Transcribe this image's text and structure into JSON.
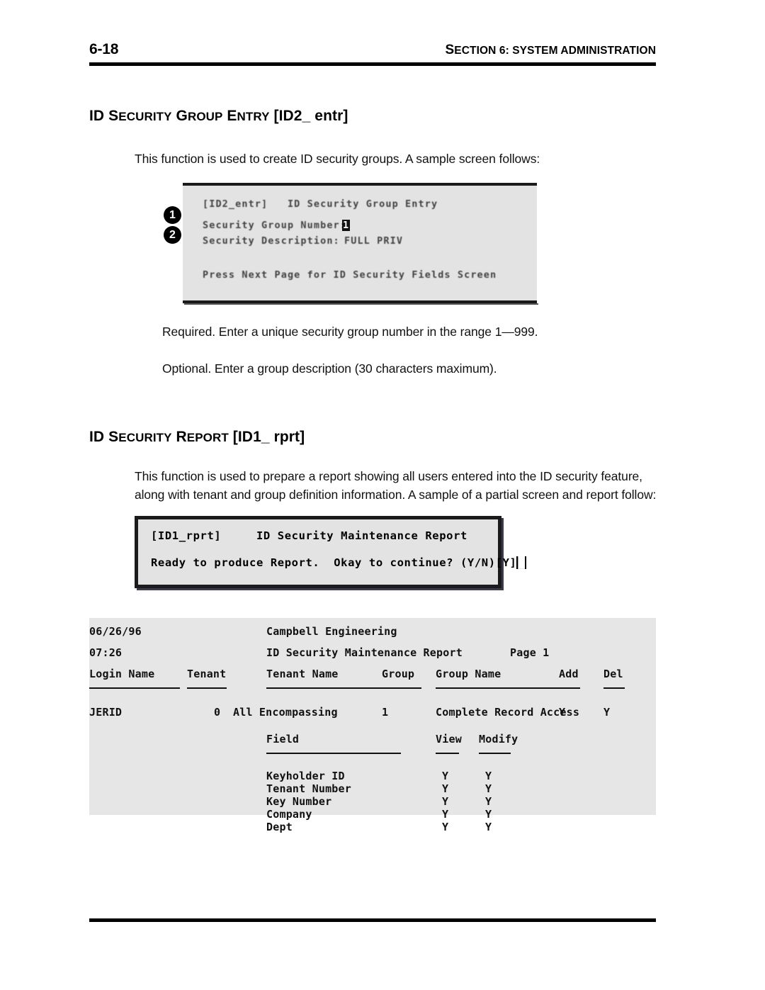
{
  "header": {
    "folio": "6-18",
    "running_head_prefix": "S",
    "running_head": "ECTION 6: SYSTEM ADMINISTRATION",
    "running_head_full": "SECTION 6: SYSTEM ADMINISTRATION"
  },
  "section1": {
    "heading_main": "ID S",
    "heading_small": "ECURITY",
    "heading_full": "ID SECURITY GROUP ENTRY [ID2_ entr]",
    "heading_parts": {
      "p1": "ID S",
      "p2": "ECURITY",
      "p3": " G",
      "p4": "ROUP",
      "p5": " E",
      "p6": "NTRY",
      "p7": " [ID2_ entr]"
    },
    "intro": "This function is used to create ID security groups.  A sample screen follows:",
    "screen": {
      "title_line": "[ID2_entr]   ID Security Group Entry",
      "field1_label": "Security Group Number:",
      "field1_value": "1",
      "field2_label": "Security Description:",
      "field2_value": "FULL PRIV",
      "footer_line": "Press Next Page for ID Security Fields Screen"
    },
    "callouts": [
      {
        "number": "1"
      },
      {
        "number": "2"
      }
    ],
    "notes": [
      "Required.  Enter a unique security group number in the range 1—999.",
      "Optional.  Enter a group description (30 characters maximum)."
    ]
  },
  "section2": {
    "heading_parts": {
      "p1": "ID S",
      "p2": "ECURITY",
      "p3": " R",
      "p4": "EPORT",
      "p5": "  [ID1_ rprt]"
    },
    "heading_full": "ID SECURITY REPORT  [ID1_ rprt]",
    "intro_line1": "This function is used to prepare a report showing all users entered into the ID security feature,",
    "intro_line2": "along with tenant and group definition information.  A sample of a partial screen and report follow:",
    "screen": {
      "title_line": "[ID1_rprt]     ID Security Maintenance Report",
      "prompt_line": "Ready to produce Report.  Okay to continue? (Y/N)[Y]",
      "cursor": "█"
    }
  },
  "report": {
    "date": "06/26/96",
    "time": "07:26",
    "company": "Campbell Engineering",
    "title": "ID Security Maintenance Report",
    "page_label": "Page 1",
    "columns": {
      "login_name": "Login Name",
      "tenant": "Tenant",
      "tenant_name": "Tenant Name",
      "group": "Group",
      "group_name": "Group Name",
      "add": "Add",
      "del": "Del"
    },
    "rows": [
      {
        "login_name": "JERID",
        "tenant": "0",
        "tenant_name": "All Encompassing",
        "group": "1",
        "group_name": "Complete Record Access",
        "add": "Y",
        "del": "Y"
      }
    ],
    "field_columns": {
      "field": "Field",
      "view": "View",
      "modify": "Modify"
    },
    "field_rows": [
      {
        "field": "Keyholder ID",
        "view": "Y",
        "modify": "Y"
      },
      {
        "field": "Tenant Number",
        "view": "Y",
        "modify": "Y"
      },
      {
        "field": "Key Number",
        "view": "Y",
        "modify": "Y"
      },
      {
        "field": "Company",
        "view": "Y",
        "modify": "Y"
      },
      {
        "field": "Dept",
        "view": "Y",
        "modify": "Y"
      }
    ]
  },
  "colors": {
    "screen_bg": "#e3e3e3",
    "report_bg": "#e6e6e6",
    "ink": "#000000",
    "border": "#1b1b1b"
  }
}
